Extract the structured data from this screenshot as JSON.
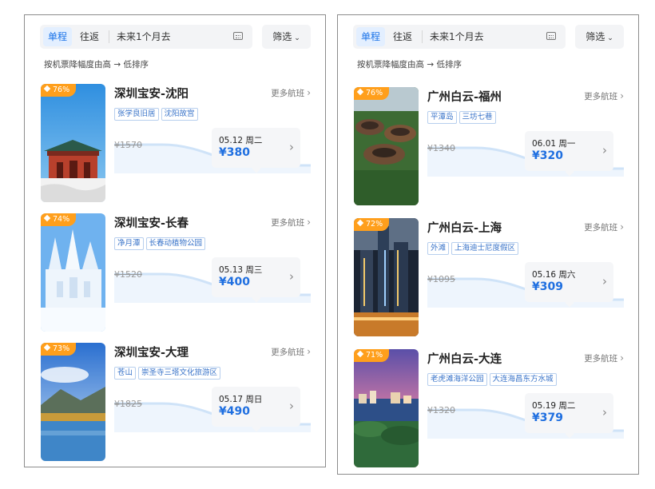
{
  "panels": [
    {
      "tabs": [
        {
          "label": "单程",
          "active": true
        },
        {
          "label": "往返",
          "active": false
        }
      ],
      "date_range": "未来1个月去",
      "filter_label": "筛选",
      "sort_hint": "按机票降幅度由高 → 低排序",
      "cards": [
        {
          "badge": "76%",
          "route": "深圳宝安-沈阳",
          "more": "更多航班",
          "tags": [
            "张学良旧居",
            "沈阳故宫"
          ],
          "old_price": "¥1570",
          "date": "05.12 周二",
          "price": "¥380",
          "photo": "temple"
        },
        {
          "badge": "74%",
          "route": "深圳宝安-长春",
          "more": "更多航班",
          "tags": [
            "净月潭",
            "长春动植物公园"
          ],
          "old_price": "¥1520",
          "date": "05.13 周三",
          "price": "¥400",
          "photo": "ice"
        },
        {
          "badge": "73%",
          "route": "深圳宝安-大理",
          "more": "更多航班",
          "tags": [
            "苍山",
            "崇圣寺三塔文化旅游区"
          ],
          "old_price": "¥1825",
          "date": "05.17 周日",
          "price": "¥490",
          "photo": "lake"
        }
      ]
    },
    {
      "tabs": [
        {
          "label": "单程",
          "active": true
        },
        {
          "label": "往返",
          "active": false
        }
      ],
      "date_range": "未来1个月去",
      "filter_label": "筛选",
      "sort_hint": "按机票降幅度由高 → 低排序",
      "cards": [
        {
          "badge": "76%",
          "route": "广州白云-福州",
          "more": "更多航班",
          "tags": [
            "平潭岛",
            "三坊七巷"
          ],
          "old_price": "¥1340",
          "date": "06.01 周一",
          "price": "¥320",
          "photo": "tulou"
        },
        {
          "badge": "72%",
          "route": "广州白云-上海",
          "more": "更多航班",
          "tags": [
            "外滩",
            "上海迪士尼度假区"
          ],
          "old_price": "¥1095",
          "date": "05.16 周六",
          "price": "¥309",
          "photo": "city"
        },
        {
          "badge": "71%",
          "route": "广州白云-大连",
          "more": "更多航班",
          "tags": [
            "老虎滩海洋公园",
            "大连海昌东方水城"
          ],
          "old_price": "¥1320",
          "date": "05.19 周二",
          "price": "¥379",
          "photo": "coast"
        }
      ]
    }
  ],
  "colors": {
    "accent": "#1f6fe0",
    "badge": "#ff9f1c",
    "tag_text": "#3a74c9",
    "curve": "#cfe3f8"
  }
}
